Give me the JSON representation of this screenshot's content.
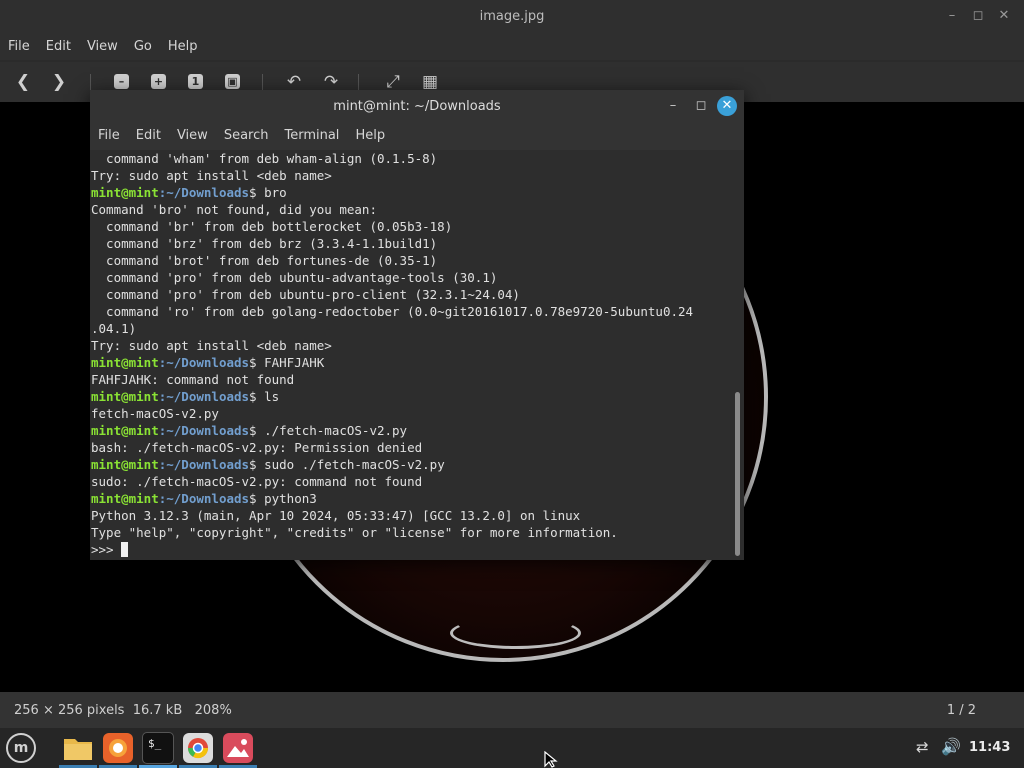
{
  "viewer": {
    "title": "image.jpg",
    "menu": [
      "File",
      "Edit",
      "View",
      "Go",
      "Help"
    ],
    "toolbar": {
      "zoom_out": "–",
      "zoom_in": "+",
      "zoom_normal": "1"
    },
    "status": {
      "info": "256 × 256 pixels  16.7 kB   208%",
      "page": "1 / 2"
    }
  },
  "terminal": {
    "title": "mint@mint: ~/Downloads",
    "menu": [
      "File",
      "Edit",
      "View",
      "Search",
      "Terminal",
      "Help"
    ],
    "prompt_user": "mint@mint",
    "prompt_path": ":~/Downloads",
    "lines": [
      {
        "t": "  command 'wham' from deb wham-align (0.1.5-8)"
      },
      {
        "t": "Try: sudo apt install <deb name>"
      },
      {
        "p": true,
        "cmd": "$ bro"
      },
      {
        "t": "Command 'bro' not found, did you mean:"
      },
      {
        "t": "  command 'br' from deb bottlerocket (0.05b3-18)"
      },
      {
        "t": "  command 'brz' from deb brz (3.3.4-1.1build1)"
      },
      {
        "t": "  command 'brot' from deb fortunes-de (0.35-1)"
      },
      {
        "t": "  command 'pro' from deb ubuntu-advantage-tools (30.1)"
      },
      {
        "t": "  command 'pro' from deb ubuntu-pro-client (32.3.1~24.04)"
      },
      {
        "t": "  command 'ro' from deb golang-redoctober (0.0~git20161017.0.78e9720-5ubuntu0.24"
      },
      {
        "t": ".04.1)"
      },
      {
        "t": "Try: sudo apt install <deb name>"
      },
      {
        "p": true,
        "cmd": "$ FAHFJAHK"
      },
      {
        "t": "FAHFJAHK: command not found"
      },
      {
        "p": true,
        "cmd": "$ ls"
      },
      {
        "t": "fetch-macOS-v2.py"
      },
      {
        "p": true,
        "cmd": "$ ./fetch-macOS-v2.py"
      },
      {
        "t": "bash: ./fetch-macOS-v2.py: Permission denied"
      },
      {
        "p": true,
        "cmd": "$ sudo ./fetch-macOS-v2.py"
      },
      {
        "t": "sudo: ./fetch-macOS-v2.py: command not found"
      },
      {
        "p": true,
        "cmd": "$ python3"
      },
      {
        "t": "Python 3.12.3 (main, Apr 10 2024, 05:33:47) [GCC 13.2.0] on linux"
      },
      {
        "t": "Type \"help\", \"copyright\", \"credits\" or \"license\" for more information."
      },
      {
        "t": ">>> ",
        "cursor": true
      }
    ]
  },
  "taskbar": {
    "clock": "11:43",
    "apps": [
      "file-manager",
      "firefox",
      "terminal",
      "chrome",
      "image-viewer"
    ],
    "colors": {
      "folder": "#e8b84a",
      "firefox": "#e8622a",
      "chrome": "#dcdcdc",
      "viewer": "#d94b5c"
    }
  }
}
